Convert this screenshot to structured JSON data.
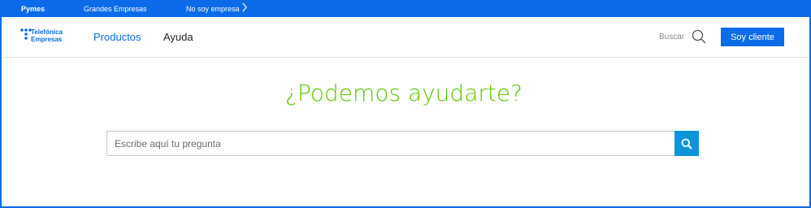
{
  "topbar": {
    "pymes": "Pymes",
    "grandes": "Grandes Empresas",
    "no_empresa": "No soy empresa",
    "chevron_icon": "chevron-right-icon"
  },
  "header": {
    "logo_text": "Telefónica\nEmpresas",
    "nav": {
      "productos": "Productos",
      "ayuda": "Ayuda"
    },
    "buscar": "Buscar",
    "cliente_button": "Soy cliente"
  },
  "main": {
    "heading": "¿Podemos ayudarte?",
    "search_placeholder": "Escribe aquí tu pregunta",
    "search_value": ""
  },
  "colors": {
    "brand_blue": "#0b6be8",
    "heading_green": "#5bc500",
    "search_button": "#0b94d9"
  }
}
